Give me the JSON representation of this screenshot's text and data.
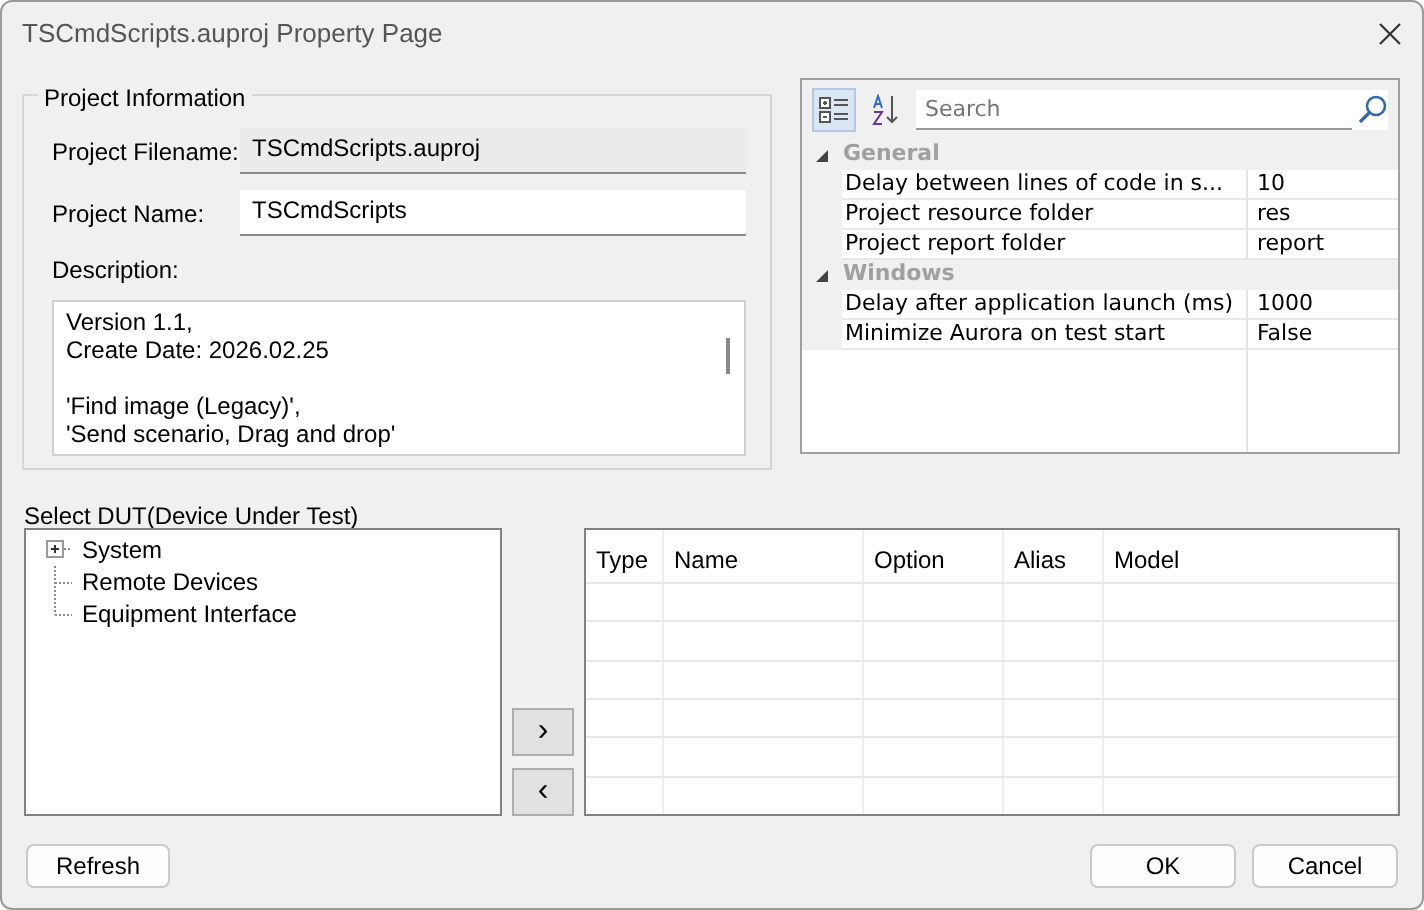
{
  "window": {
    "title": "TSCmdScripts.auproj Property Page"
  },
  "project_information": {
    "title": "Project Information",
    "fields": [
      {
        "label": "Project Filename:",
        "value": "TSCmdScripts.auproj",
        "disabled": true
      },
      {
        "label": "Project Name:",
        "value": "TSCmdScripts",
        "disabled": false
      }
    ],
    "description": {
      "label": "Description:",
      "paragraphs": [
        [
          "Version 1.1,",
          "Create Date: 2026.02.25"
        ],
        [
          "'Find image (Legacy)',",
          "'Send scenario, Drag and drop'"
        ]
      ]
    }
  },
  "property_grid": {
    "toolbar": [
      {
        "kind": "categorized",
        "selected": true
      },
      {
        "kind": "alphabetical",
        "selected": false
      }
    ],
    "search": {
      "placeholder": "Search"
    },
    "categories": [
      {
        "name": "General",
        "expanded": true,
        "properties": [
          {
            "name": "Delay between lines of code in s...",
            "value": "10"
          },
          {
            "name": "Project resource folder",
            "value": "res"
          },
          {
            "name": "Project report folder",
            "value": "report"
          }
        ]
      },
      {
        "name": "Windows",
        "expanded": true,
        "properties": [
          {
            "name": "Delay after application launch (ms)",
            "value": "1000"
          },
          {
            "name": "Minimize Aurora on test start",
            "value": "False"
          }
        ]
      }
    ]
  },
  "dut": {
    "title": "Select DUT(Device Under Test)",
    "tree": [
      {
        "label": "System",
        "expanded": false
      },
      {
        "label": "Remote Devices"
      },
      {
        "label": "Equipment Interface"
      }
    ],
    "move_buttons": [
      "›",
      "‹"
    ],
    "table": {
      "columns": [
        "Type",
        "Name",
        "Option",
        "Alias",
        "Model"
      ]
    }
  },
  "buttons": {
    "left": [
      "Refresh"
    ],
    "right": [
      "OK",
      "Cancel"
    ]
  }
}
